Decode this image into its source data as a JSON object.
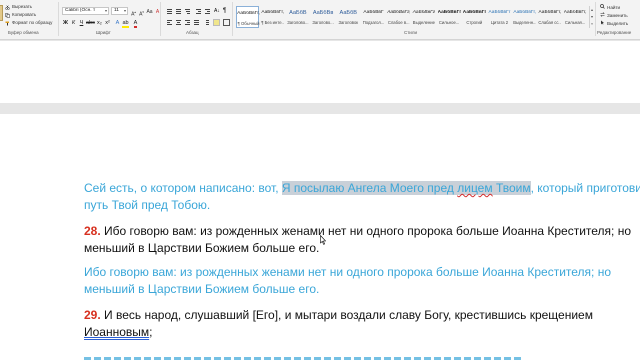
{
  "ribbon": {
    "clipboard": {
      "items": [
        "Вырезать",
        "Копировать",
        "Формат по образцу"
      ],
      "group_label": "Буфер обмена"
    },
    "font": {
      "font_name": "Calibri (Осн. т",
      "font_size": "11",
      "group_label": "Шрифт"
    },
    "paragraph": {
      "group_label": "Абзац"
    },
    "styles": {
      "group_label": "Стили",
      "items": [
        {
          "sample": "АаБбВвГг,",
          "name": "¶ Обычный"
        },
        {
          "sample": "АаБбВвГг,",
          "name": "¶ Без инте..."
        },
        {
          "sample": "АаБбВ",
          "name": "Заголово..."
        },
        {
          "sample": "АаБбВв",
          "name": "Заголово..."
        },
        {
          "sample": "АаБбВ",
          "name": "Заголовок"
        },
        {
          "sample": "АаБбВвГ",
          "name": "Подзагол..."
        },
        {
          "sample": "АаБбВвГг,",
          "name": "Слабое в..."
        },
        {
          "sample": "АаБбВвГг",
          "name": "Выделение"
        },
        {
          "sample": "АаБбВвГг,",
          "name": "Сильное..."
        },
        {
          "sample": "АаБбВвГг,",
          "name": "Строгий"
        },
        {
          "sample": "АаБбВвГг",
          "name": "Цитата 2"
        },
        {
          "sample": "АаБбВвГг,",
          "name": "Выделенн..."
        },
        {
          "sample": "АаБбВвГг,",
          "name": "Слабая сс..."
        },
        {
          "sample": "АаБбВвГг,",
          "name": "Сильная..."
        }
      ]
    },
    "editing": {
      "items": [
        "Найти",
        "Заменить",
        "Выделить"
      ],
      "group_label": "Редактирование"
    }
  },
  "document": {
    "p1": {
      "line1_before": "Сей есть, о котором написано: вот, ",
      "line1_hl_a": "Я посылаю Ангела Моего пред ",
      "line1_hl_sq": "лицем",
      "line1_hl_b": " Твоим",
      "line1_after": ", который приготовит",
      "line2": "путь Твой пред Тобою."
    },
    "p2": {
      "num": "28.",
      "line1_text": " Ибо говорю вам: из рожденных женами нет ни одного пророка больше Иоанна Крестителя; но",
      "line2": "меньший в Царствии Божием больше его."
    },
    "p3": {
      "line1": "Ибо говорю вам: из рожденных женами нет ни одного пророка больше Иоанна Крестителя; но",
      "line2": "меньший в Царствии Божием больше его."
    },
    "p4": {
      "num": "29.",
      "line1_text": " И весь народ, слушавший [Его], и мытари воздали славу Богу, крестившись крещением",
      "line2_sq": "Иоанновым",
      "line2_after": ";"
    }
  }
}
